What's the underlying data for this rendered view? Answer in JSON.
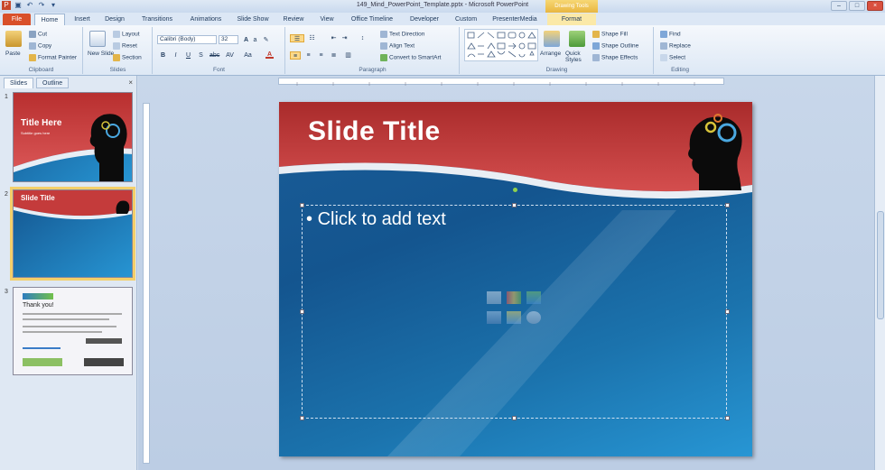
{
  "window": {
    "title": "149_Mind_PowerPoint_Template.pptx - Microsoft PowerPoint",
    "context_label": "Drawing Tools"
  },
  "tabs": [
    "File",
    "Home",
    "Insert",
    "Design",
    "Transitions",
    "Animations",
    "Slide Show",
    "Review",
    "View",
    "Office Timeline",
    "Developer",
    "Custom",
    "PresenterMedia",
    "Format"
  ],
  "ribbon": {
    "clipboard": {
      "label": "Clipboard",
      "paste": "Paste",
      "cut": "Cut",
      "copy": "Copy",
      "format_painter": "Format Painter"
    },
    "slides": {
      "label": "Slides",
      "new_slide": "New Slide",
      "layout": "Layout",
      "reset": "Reset",
      "section": "Section"
    },
    "font": {
      "label": "Font",
      "family": "Calibri (Body)",
      "size": "32"
    },
    "paragraph": {
      "label": "Paragraph",
      "text_direction": "Text Direction",
      "align_text": "Align Text",
      "convert_smartart": "Convert to SmartArt"
    },
    "drawing": {
      "label": "Drawing",
      "arrange": "Arrange",
      "quick_styles": "Quick Styles",
      "shape_fill": "Shape Fill",
      "shape_outline": "Shape Outline",
      "shape_effects": "Shape Effects"
    },
    "editing": {
      "label": "Editing",
      "find": "Find",
      "replace": "Replace",
      "select": "Select"
    }
  },
  "panel": {
    "tab_slides": "Slides",
    "tab_outline": "Outline",
    "close": "×"
  },
  "thumbnails": [
    {
      "number": "1",
      "title": "Title Here",
      "subtitle": "Subtitle goes here"
    },
    {
      "number": "2",
      "title": "Slide Title"
    },
    {
      "number": "3",
      "title": "Thank you!"
    }
  ],
  "slide": {
    "title": "Slide Title",
    "bullet": "Click to add text"
  },
  "colors": {
    "banner_red": "#c43b3b",
    "slide_blue": "#1a5d98",
    "file_tab": "#d9502a",
    "selection": "#f4cf6a"
  }
}
